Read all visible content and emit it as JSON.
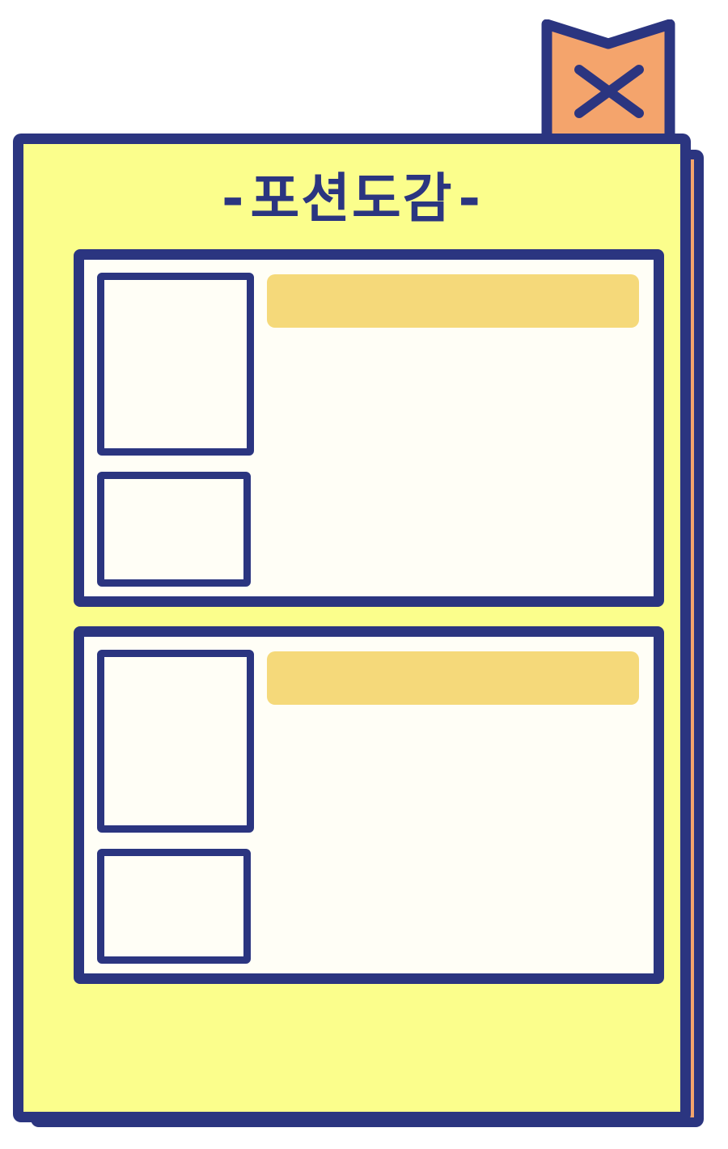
{
  "window": {
    "title": "-포션도감-"
  },
  "header": {
    "close_icon": "close-x-icon"
  },
  "entries": [
    {
      "name": "",
      "description": ""
    },
    {
      "name": "",
      "description": ""
    }
  ],
  "colors": {
    "outline": "#2b3580",
    "page": "#fbfe8c",
    "card": "#fffef6",
    "name_bar": "#f5d97a",
    "accent": "#f4a46c"
  }
}
